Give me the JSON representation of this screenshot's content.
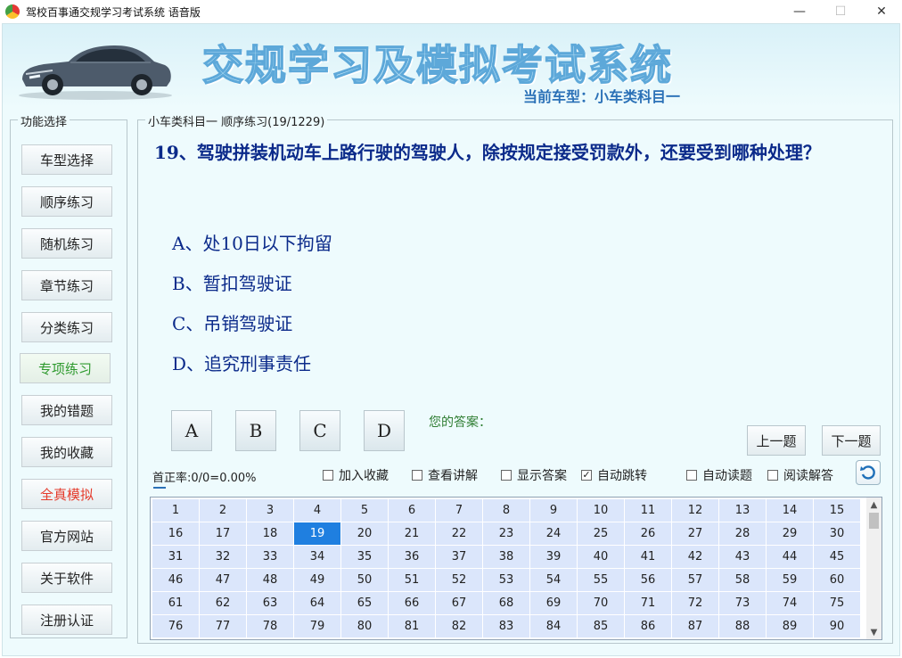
{
  "window": {
    "title": "驾校百事通交规学习考试系统 语音版",
    "minimize_glyph": "—",
    "maximize_glyph": "☐",
    "close_glyph": "✕"
  },
  "banner": {
    "title": "交规学习及模拟考试系统",
    "subtitle": "当前车型：小车类科目一"
  },
  "sidebar": {
    "legend": "功能选择",
    "items": [
      {
        "label": "车型选择"
      },
      {
        "label": "顺序练习"
      },
      {
        "label": "随机练习"
      },
      {
        "label": "章节练习"
      },
      {
        "label": "分类练习"
      },
      {
        "label": "专项练习"
      },
      {
        "label": "我的错题"
      },
      {
        "label": "我的收藏"
      },
      {
        "label": "全真模拟"
      },
      {
        "label": "官方网站"
      },
      {
        "label": "关于软件"
      },
      {
        "label": "注册认证"
      }
    ]
  },
  "panel": {
    "legend": "小车类科目一 顺序练习(19/1229)"
  },
  "question": {
    "text": "19、驾驶拼装机动车上路行驶的驾驶人，除按规定接受罚款外，还要受到哪种处理？",
    "options": [
      "A、处10日以下拘留",
      "B、暂扣驾驶证",
      "C、吊销驾驶证",
      "D、追究刑事责任"
    ]
  },
  "answer_buttons": [
    "A",
    "B",
    "C",
    "D"
  ],
  "your_answer_label": "您的答案：",
  "nav": {
    "prev": "上一题",
    "next": "下一题"
  },
  "accuracy": "首正率:0/0=0.00%",
  "checkboxes": [
    {
      "label": "加入收藏",
      "checked": false
    },
    {
      "label": "查看讲解",
      "checked": false
    },
    {
      "label": "显示答案",
      "checked": false
    },
    {
      "label": "自动跳转",
      "checked": true
    },
    {
      "label": "自动读题",
      "checked": false
    },
    {
      "label": "阅读解答",
      "checked": false
    }
  ],
  "grid": {
    "columns": 15,
    "visible_rows": 6,
    "selected": 19,
    "numbers": [
      1,
      2,
      3,
      4,
      5,
      6,
      7,
      8,
      9,
      10,
      11,
      12,
      13,
      14,
      15,
      16,
      17,
      18,
      19,
      20,
      21,
      22,
      23,
      24,
      25,
      26,
      27,
      28,
      29,
      30,
      31,
      32,
      33,
      34,
      35,
      36,
      37,
      38,
      39,
      40,
      41,
      42,
      43,
      44,
      45,
      46,
      47,
      48,
      49,
      50,
      51,
      52,
      53,
      54,
      55,
      56,
      57,
      58,
      59,
      60,
      61,
      62,
      63,
      64,
      65,
      66,
      67,
      68,
      69,
      70,
      71,
      72,
      73,
      74,
      75,
      76,
      77,
      78,
      79,
      80,
      81,
      82,
      83,
      84,
      85,
      86,
      87,
      88,
      89,
      90
    ]
  }
}
